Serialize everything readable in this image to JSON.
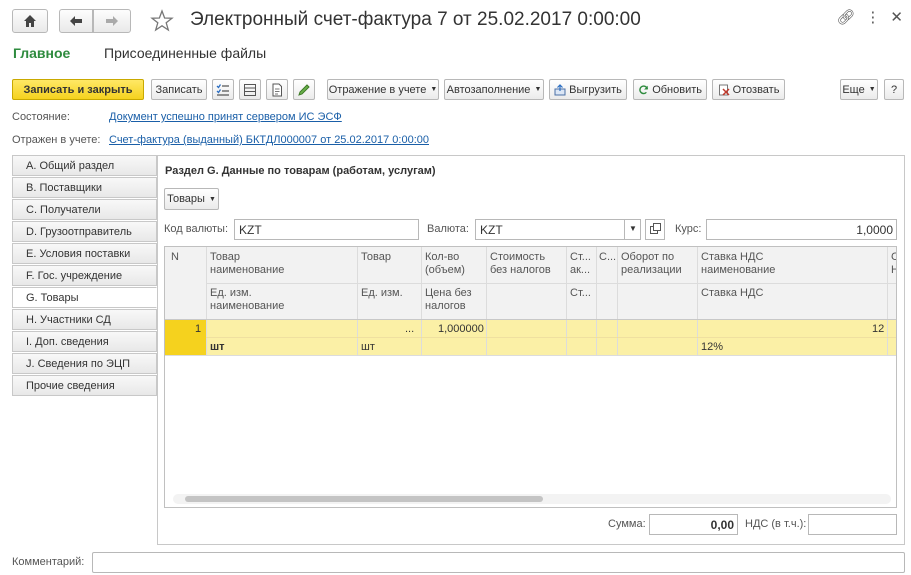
{
  "window": {
    "title": "Электронный счет-фактура 7 от 25.02.2017 0:00:00",
    "icons": [
      "link-icon",
      "more-icon",
      "close-icon"
    ]
  },
  "nav": {
    "main": "Главное",
    "attached": "Присоединенные файлы"
  },
  "toolbar": {
    "save_close": "Записать и закрыть",
    "save": "Записать",
    "reflection": "Отражение в учете",
    "autofill": "Автозаполнение",
    "export": "Выгрузить",
    "refresh": "Обновить",
    "recall": "Отозвать",
    "more": "Еще"
  },
  "status": {
    "state_label": "Состояние:",
    "state_value": "Документ успешно принят сервером ИС ЭСФ",
    "reflected_label": "Отражен в учете:",
    "reflected_value": "Счет-фактура (выданный) БКТДЛ000007 от 25.02.2017 0:00:00"
  },
  "sections": [
    "A. Общий раздел",
    "B. Поставщики",
    "C. Получатели",
    "D. Грузоотправитель",
    "E. Условия поставки",
    "F. Гос. учреждение",
    "G. Товары",
    "H. Участники СД",
    "I. Доп. сведения",
    "J. Сведения по ЭЦП",
    "Прочие сведения"
  ],
  "panel": {
    "heading": "Раздел G. Данные по товарам (работам, услугам)",
    "goods_button": "Товары",
    "currency_code_label": "Код валюты:",
    "currency_code_value": "KZT",
    "currency_label": "Валюта:",
    "currency_value": "KZT",
    "rate_label": "Курс:",
    "rate_value": "1,0000",
    "sum_label": "Сумма:",
    "sum_value": "0,00",
    "vat_label": "НДС (в т.ч.):",
    "vat_value": ""
  },
  "grid": {
    "headers": {
      "n": "N",
      "goods_top": "Товар",
      "goods_top2": "наименование",
      "goods_unit": "Ед. изм.",
      "goods_unit2": "наименование",
      "goods": "Товар",
      "unit": "Ед. изм.",
      "qty": "Кол-во",
      "qty2": "(объем)",
      "price": "Цена без",
      "price2": "налогов",
      "cost": "Стоимость",
      "cost2": "без налогов",
      "st1": "Ст...",
      "st1b": "ак...",
      "st2": "Ст...",
      "c": "С...",
      "turnover": "Оборот по",
      "turnover2": "реализации",
      "vat_rate": "Ставка НДС",
      "vat_rate2": "наименование",
      "vat_rate3": "Ставка НДС",
      "cut1": "С",
      "cut2": "Н"
    },
    "row": {
      "n": "1",
      "goods_dots": "...",
      "qty": "1,000000",
      "vat_right": "12",
      "unit_name": "шт",
      "unit": "шт",
      "vat_pct": "12%"
    }
  },
  "footer": {
    "comment_label": "Комментарий:"
  }
}
